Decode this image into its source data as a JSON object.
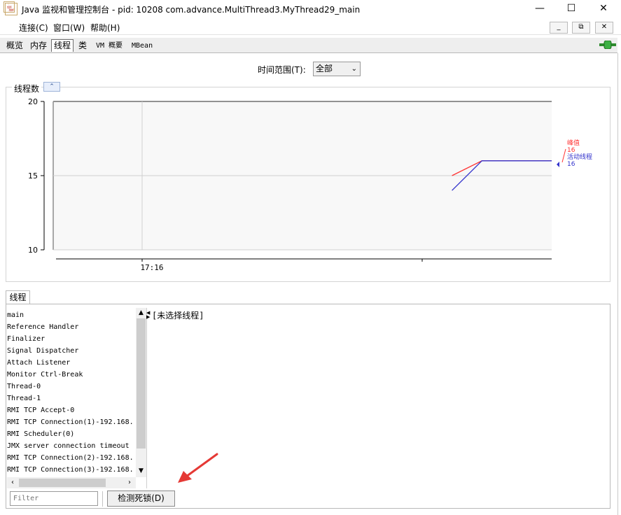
{
  "window": {
    "title": "Java 监视和管理控制台 - pid: 10208 com.advance.MultiThread3.MyThread29_main",
    "minimize": "—",
    "maximize": "☐",
    "close": "✕"
  },
  "menu": {
    "items": [
      "连接(C)",
      "窗口(W)",
      "帮助(H)"
    ],
    "mdi_buttons": [
      "_",
      "⧉",
      "✕"
    ]
  },
  "tabs": [
    {
      "label": "概览",
      "selected": false
    },
    {
      "label": "内存",
      "selected": false
    },
    {
      "label": "线程",
      "selected": true
    },
    {
      "label": "类",
      "selected": false
    },
    {
      "label": "VM 概要",
      "selected": false
    },
    {
      "label": "MBean",
      "selected": false
    }
  ],
  "time_range": {
    "label": "时间范围(T):",
    "value": "全部"
  },
  "chart_panel": {
    "title": "线程数"
  },
  "chart_data": {
    "type": "line",
    "ylim": [
      10,
      20
    ],
    "y_ticks": [
      10,
      15,
      20
    ],
    "x_ticks": [
      "17:16"
    ],
    "grid": true,
    "legend_position": "right",
    "series": [
      {
        "name": "峰值",
        "color": "#ff3333",
        "value_label": "16",
        "points": [
          [
            0.8,
            15
          ],
          [
            0.86,
            16
          ],
          [
            1.0,
            16
          ]
        ]
      },
      {
        "name": "活动线程",
        "color": "#3333cc",
        "value_label": "16",
        "points": [
          [
            0.8,
            14
          ],
          [
            0.86,
            16
          ],
          [
            1.0,
            16
          ]
        ]
      }
    ]
  },
  "threads": {
    "tab_label": "线程",
    "list": [
      "main",
      "Reference Handler",
      "Finalizer",
      "Signal Dispatcher",
      "Attach Listener",
      "Monitor Ctrl-Break",
      "Thread-0",
      "Thread-1",
      "RMI TCP Accept-0",
      "RMI TCP Connection(1)-192.168.",
      "RMI Scheduler(0)",
      "JMX server connection timeout",
      "RMI TCP Connection(2)-192.168.",
      "RMI TCP Connection(3)-192.168."
    ],
    "detail": "[未选择线程]",
    "filter_placeholder": "Filter",
    "detect_deadlock_label": "检测死锁(D)"
  },
  "colors": {
    "peak": "#ff3333",
    "live": "#3333cc",
    "annotation_arrow": "#e53935"
  }
}
